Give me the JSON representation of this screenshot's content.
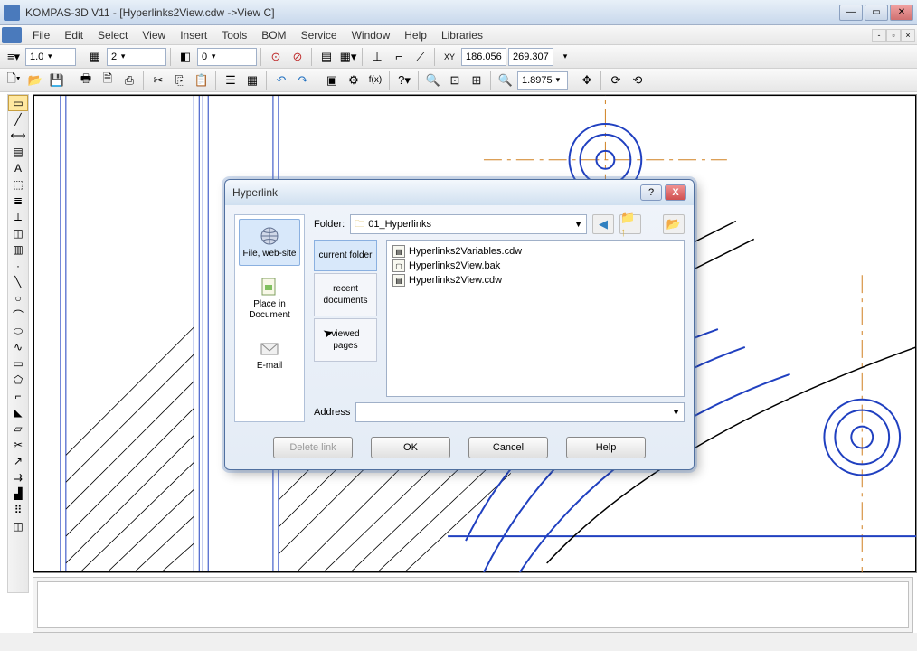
{
  "titlebar": {
    "text": "KOMPAS-3D V11 - [Hyperlinks2View.cdw ->View C]"
  },
  "menu": {
    "items": [
      "File",
      "Edit",
      "Select",
      "View",
      "Insert",
      "Tools",
      "BOM",
      "Service",
      "Window",
      "Help",
      "Libraries"
    ]
  },
  "toolbar1": {
    "combo1": "1.0",
    "combo2": "2",
    "combo3": "0",
    "coord_x": "186.056",
    "coord_y": "269.307"
  },
  "toolbar2": {
    "zoom": "1.8975"
  },
  "dialog": {
    "title": "Hyperlink",
    "folder_label": "Folder:",
    "folder_value": "01_Hyperlinks",
    "link_types": [
      {
        "label": "File,\nweb-site",
        "active": true
      },
      {
        "label": "Place\nin Document",
        "active": false
      },
      {
        "label": "E-mail",
        "active": false
      }
    ],
    "browse_tabs": [
      {
        "label": "current\nfolder",
        "active": true
      },
      {
        "label": "recent\ndocuments",
        "active": false
      },
      {
        "label": "viewed\npages",
        "active": false
      }
    ],
    "files": [
      {
        "name": "Hyperlinks2Variables.cdw"
      },
      {
        "name": "Hyperlinks2View.bak"
      },
      {
        "name": "Hyperlinks2View.cdw"
      }
    ],
    "address_label": "Address",
    "address_value": "",
    "buttons": {
      "delete": "Delete link",
      "ok": "OK",
      "cancel": "Cancel",
      "help": "Help"
    }
  }
}
